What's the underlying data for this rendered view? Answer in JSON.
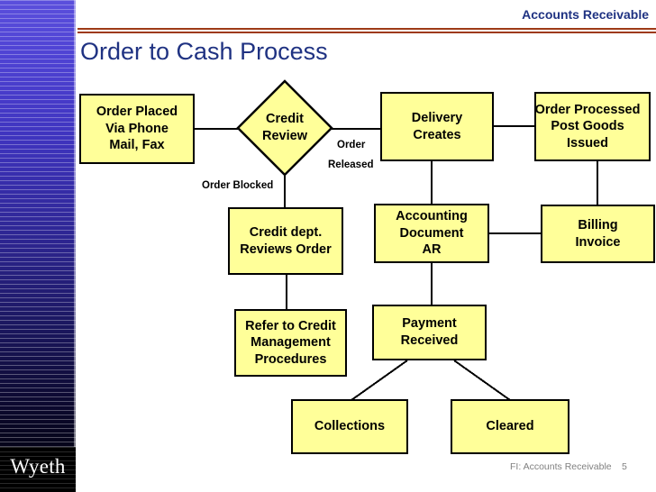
{
  "header": {
    "section_title": "Accounts Receivable"
  },
  "slide": {
    "title": "Order to Cash Process"
  },
  "branding": {
    "logo_text": "Wyeth"
  },
  "footer": {
    "note": "FI: Accounts Receivable",
    "page_number": "5"
  },
  "colors": {
    "node_fill": "#FFFF99",
    "node_border": "#000000",
    "title_blue": "#1F3282",
    "rule_red": "#9E3A17",
    "sidebar_top": "#5B4FDC",
    "sidebar_bottom": "#000000",
    "footer_gray": "#808080"
  },
  "flowchart": {
    "nodes": [
      {
        "id": "order-placed",
        "label": "Order Placed\nVia Phone\nMail, Fax",
        "shape": "box"
      },
      {
        "id": "credit-review",
        "label": "Credit\nReview",
        "shape": "diamond"
      },
      {
        "id": "delivery-creates",
        "label": "Delivery\nCreates",
        "shape": "box"
      },
      {
        "id": "order-processed",
        "label": "Order Processed\nPost Goods\nIssued",
        "shape": "box"
      },
      {
        "id": "credit-dept",
        "label": "Credit dept.\nReviews Order",
        "shape": "box"
      },
      {
        "id": "accounting-document",
        "label": "Accounting\nDocument\nAR",
        "shape": "box"
      },
      {
        "id": "billing-invoice",
        "label": "Billing\nInvoice",
        "shape": "box"
      },
      {
        "id": "refer-to-credit",
        "label": "Refer to Credit\nManagement\nProcedures",
        "shape": "box"
      },
      {
        "id": "payment-received",
        "label": "Payment\nReceived",
        "shape": "box"
      },
      {
        "id": "collections",
        "label": "Collections",
        "shape": "box"
      },
      {
        "id": "cleared",
        "label": "Cleared",
        "shape": "box"
      }
    ],
    "edge_labels": [
      {
        "id": "order",
        "text": "Order"
      },
      {
        "id": "released",
        "text": "Released"
      },
      {
        "id": "order-blocked",
        "text": "Order Blocked"
      }
    ]
  }
}
